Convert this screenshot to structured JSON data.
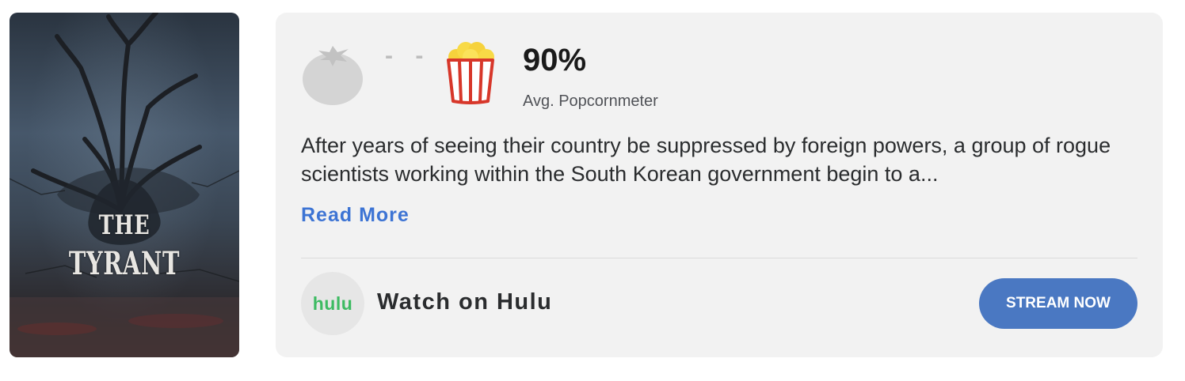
{
  "poster": {
    "title_line1": "THE",
    "title_line2": "TYRANT"
  },
  "scores": {
    "tomatometer_icon": "tomato-icon",
    "tomatometer_value": "- -",
    "audience_icon": "popcorn-icon",
    "audience_value": "90%",
    "audience_label": "Avg. Popcornmeter"
  },
  "synopsis": {
    "text": "After years of seeing their country be suppressed by foreign powers, a group of rogue scientists working within the South Korean government begin to a...",
    "read_more_label": "Read More"
  },
  "streaming": {
    "provider_logo": "hulu",
    "watch_label": "Watch on Hulu",
    "button_label": "STREAM NOW"
  },
  "colors": {
    "card_background": "#f2f2f2",
    "link": "#3d74d4",
    "button": "#4a78c2",
    "hulu_green": "#3dbb62",
    "popcorn_red": "#d7372a"
  }
}
